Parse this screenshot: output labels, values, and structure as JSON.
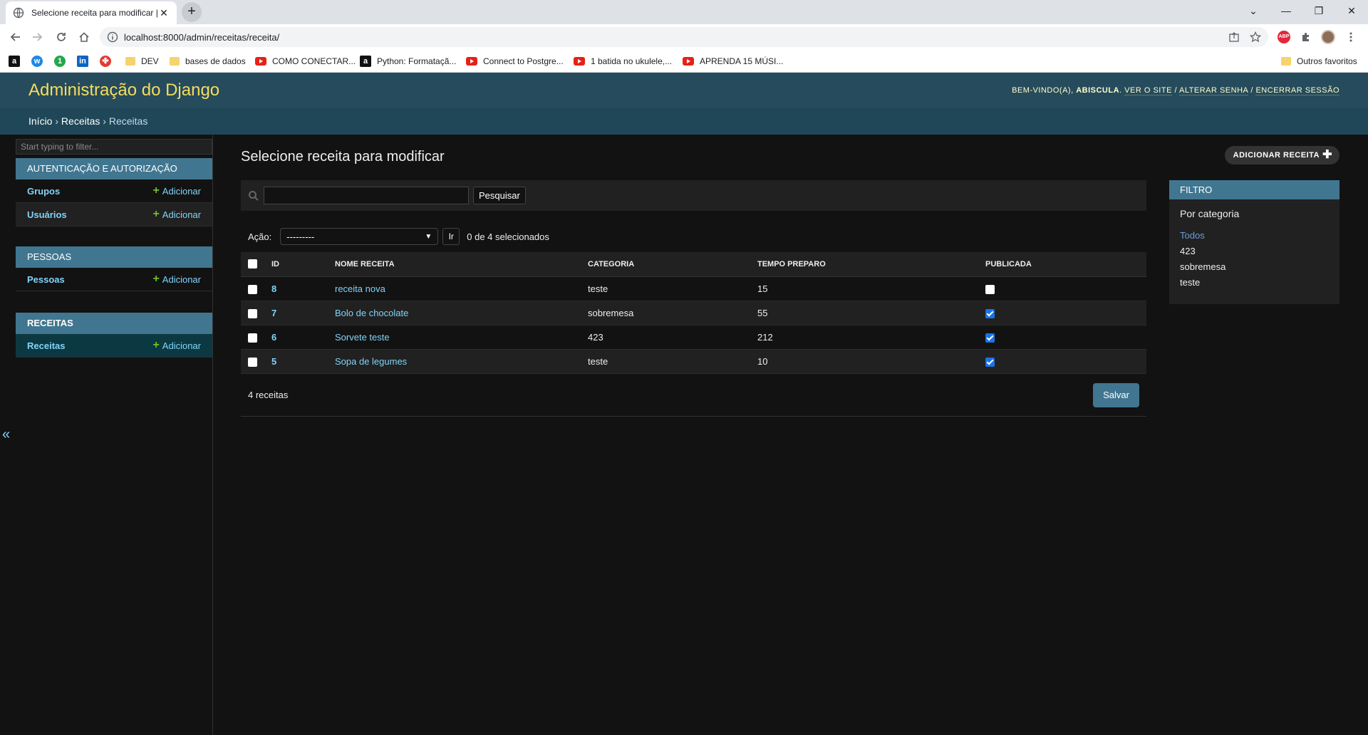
{
  "browser": {
    "tab_title": "Selecione receita para modificar | Site de administração do Django",
    "url": "localhost:8000/admin/receitas/receita/",
    "bookmarks": [
      {
        "label": "",
        "icon": "amazon-icon"
      },
      {
        "label": "",
        "icon": "w-icon"
      },
      {
        "label": "",
        "icon": "one-icon"
      },
      {
        "label": "",
        "icon": "linkedin-icon"
      },
      {
        "label": "",
        "icon": "puzzle-icon"
      },
      {
        "label": "DEV",
        "icon": "folder-icon"
      },
      {
        "label": "bases de dados",
        "icon": "folder-icon"
      },
      {
        "label": "COMO CONECTAR...",
        "icon": "youtube-icon"
      },
      {
        "label": "Python: Formataçã...",
        "icon": "amazon-icon"
      },
      {
        "label": "Connect to Postgre...",
        "icon": "youtube-icon"
      },
      {
        "label": "1 batida no ukulele,...",
        "icon": "youtube-icon"
      },
      {
        "label": "APRENDA 15 MÚSI...",
        "icon": "youtube-icon"
      }
    ],
    "other_bookmarks": "Outros favoritos"
  },
  "header": {
    "branding": "Administração do Django",
    "welcome": "Bem-vindo(a),",
    "username": "abiscula",
    "view_site": "Ver o site",
    "change_password": "Alterar senha",
    "logout": "Encerrar sessão",
    "sep": "/"
  },
  "breadcrumbs": {
    "home": "Início",
    "app": "Receitas",
    "model": "Receitas",
    "sep": "›"
  },
  "sidebar": {
    "filter_placeholder": "Start typing to filter...",
    "add_label": "Adicionar",
    "modules": [
      {
        "caption": "Autenticação e Autorização",
        "models": [
          "Grupos",
          "Usuários"
        ]
      },
      {
        "caption": "Pessoas",
        "models": [
          "Pessoas"
        ]
      },
      {
        "caption": "Receitas",
        "models": [
          "Receitas"
        ]
      }
    ],
    "toggle": "«"
  },
  "main": {
    "title": "Selecione receita para modificar",
    "add_button": "Adicionar receita",
    "search_button": "Pesquisar",
    "action_label": "Ação:",
    "action_selected": "---------",
    "go_button": "Ir",
    "selection_counter": "0 de 4 selecionados",
    "columns": [
      "ID",
      "Nome receita",
      "Categoria",
      "Tempo preparo",
      "Publicada"
    ],
    "rows": [
      {
        "id": "8",
        "nome": "receita nova",
        "categoria": "teste",
        "tempo": "15",
        "publicada": false
      },
      {
        "id": "7",
        "nome": "Bolo de chocolate",
        "categoria": "sobremesa",
        "tempo": "55",
        "publicada": true
      },
      {
        "id": "6",
        "nome": "Sorvete teste",
        "categoria": "423",
        "tempo": "212",
        "publicada": true
      },
      {
        "id": "5",
        "nome": "Sopa de legumes",
        "categoria": "teste",
        "tempo": "10",
        "publicada": true
      }
    ],
    "result_count": "4 receitas",
    "save_button": "Salvar"
  },
  "filter": {
    "title": "Filtro",
    "subtitle": "Por categoria",
    "options": [
      "Todos",
      "423",
      "sobremesa",
      "teste"
    ],
    "selected": "Todos"
  },
  "colors": {
    "header_bg": "#264b5d",
    "branding": "#f5dd5d",
    "module_caption": "#417690",
    "link": "#81d4fa",
    "add_plus": "#70bf2b"
  }
}
